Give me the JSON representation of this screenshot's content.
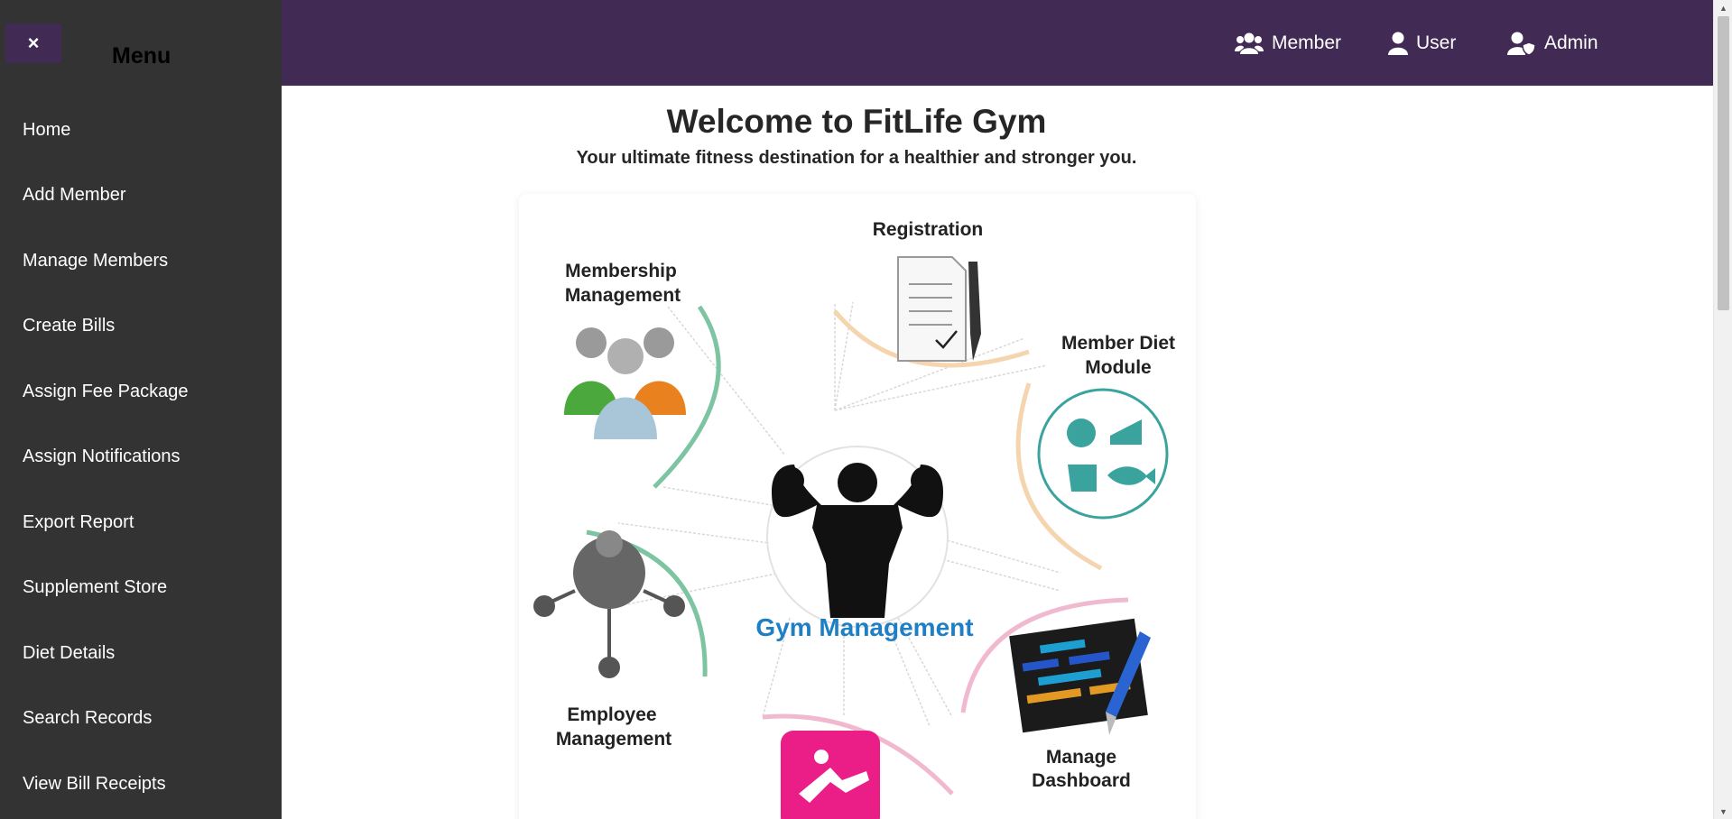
{
  "sidebar": {
    "close_label": "×",
    "title": "Menu",
    "items": [
      {
        "label": "Home"
      },
      {
        "label": "Add Member"
      },
      {
        "label": "Manage Members"
      },
      {
        "label": "Create Bills"
      },
      {
        "label": "Assign Fee Package"
      },
      {
        "label": "Assign Notifications"
      },
      {
        "label": "Export Report"
      },
      {
        "label": "Supplement Store"
      },
      {
        "label": "Diet Details"
      },
      {
        "label": "Search Records"
      },
      {
        "label": "View Bill Receipts"
      }
    ]
  },
  "topbar": {
    "member_label": "Member",
    "member_icon": "users-icon",
    "user_label": "User",
    "user_icon": "user-icon",
    "admin_label": "Admin",
    "admin_icon": "user-shield-icon"
  },
  "main": {
    "title": "Welcome to FitLife Gym",
    "subtitle": "Your ultimate fitness destination for a healthier and stronger you."
  },
  "diagram": {
    "center_label": "Gym Management",
    "registration": "Registration",
    "membership_line1": "Membership",
    "membership_line2": "Management",
    "diet_line1": "Member Diet",
    "diet_line2": "Module",
    "employee_line1": "Employee",
    "employee_line2": "Management",
    "dashboard_line1": "Manage",
    "dashboard_line2": "Dashboard"
  },
  "colors": {
    "sidebar_bg": "#333333",
    "topbar_bg": "#412a54",
    "accent_blue": "#1f7fc4",
    "teal": "#3aa39e"
  }
}
